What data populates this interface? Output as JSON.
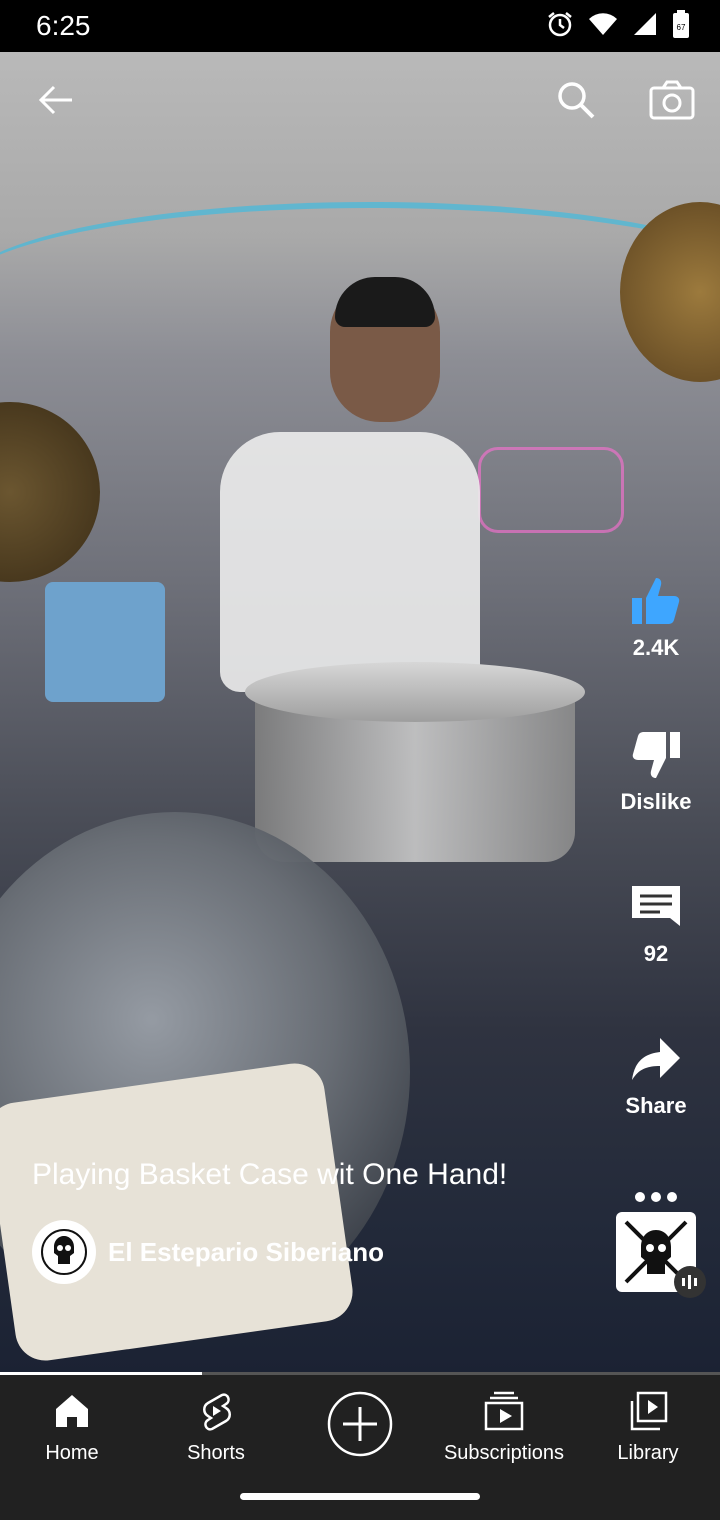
{
  "status": {
    "time": "6:25",
    "battery": "67"
  },
  "top_bar": {
    "icons": [
      "back-arrow-icon",
      "search-icon",
      "camera-icon"
    ]
  },
  "actions": {
    "like_count": "2.4K",
    "dislike_label": "Dislike",
    "comments_count": "92",
    "share_label": "Share"
  },
  "video": {
    "title": "Playing Basket Case wit One Hand!",
    "channel": "El Estepario Siberiano",
    "progress": 0.28
  },
  "nav": {
    "items": [
      {
        "label": "Home",
        "icon": "home-icon"
      },
      {
        "label": "Shorts",
        "icon": "shorts-icon"
      },
      {
        "label": "",
        "icon": "create-plus-icon"
      },
      {
        "label": "Subscriptions",
        "icon": "subscriptions-icon"
      },
      {
        "label": "Library",
        "icon": "library-icon"
      }
    ]
  },
  "colors": {
    "like_blue": "#3ea6ff",
    "nav_bg": "#212121"
  }
}
